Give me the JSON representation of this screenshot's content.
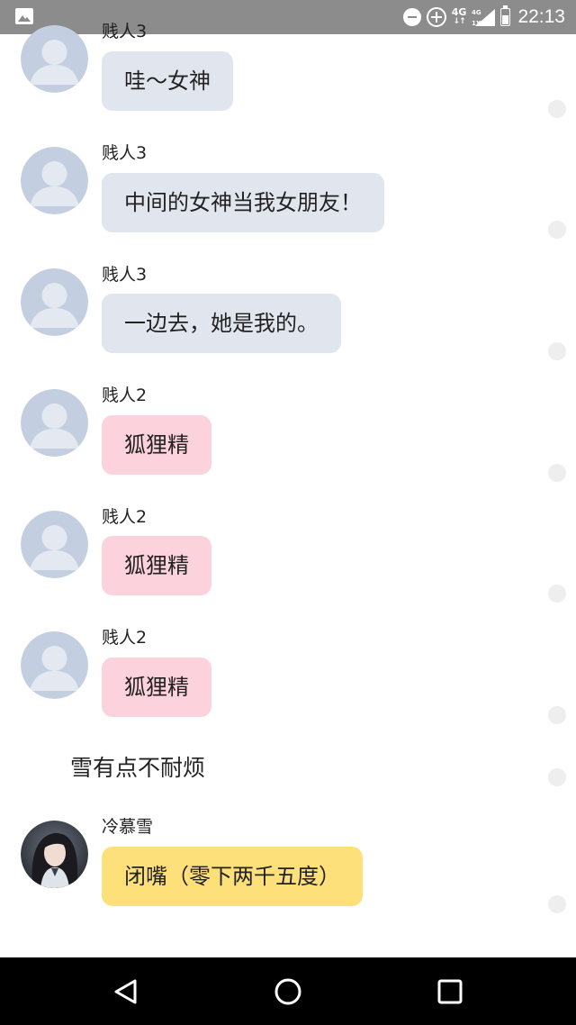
{
  "status_bar": {
    "time": "22:13",
    "network_top": "4G",
    "network_arrows": "↓↑",
    "signal_top": "4G",
    "signal_bottom": "1X",
    "icons": [
      "picture-icon",
      "dnd-icon",
      "data-saver-icon",
      "network-4g-icon",
      "signal-icon",
      "battery-icon"
    ],
    "battery_level": 0.6
  },
  "messages": [
    {
      "sender": "贱人3",
      "text": "哇～女神",
      "bubble_color": "#e1e6ee",
      "avatar": "default-avatar"
    },
    {
      "sender": "贱人3",
      "text": "中间的女神当我女朋友！",
      "bubble_color": "#e1e6ee",
      "avatar": "default-avatar"
    },
    {
      "sender": "贱人3",
      "text": "一边去，她是我的。",
      "bubble_color": "#e1e6ee",
      "avatar": "default-avatar"
    },
    {
      "sender": "贱人2",
      "text": "狐狸精",
      "bubble_color": "#fcd2dc",
      "avatar": "default-avatar"
    },
    {
      "sender": "贱人2",
      "text": "狐狸精",
      "bubble_color": "#fcd2dc",
      "avatar": "default-avatar"
    },
    {
      "sender": "贱人2",
      "text": "狐狸精",
      "bubble_color": "#fcd2dc",
      "avatar": "default-avatar"
    }
  ],
  "narration": "雪有点不耐烦",
  "last_message": {
    "sender": "冷慕雪",
    "text": "闭嘴（零下两千五度）",
    "bubble_color": "#fde07a",
    "avatar": "photo-avatar"
  },
  "navigation": [
    "back-icon",
    "home-icon",
    "recents-icon"
  ],
  "colors": {
    "status_bar": "#8c8c8c",
    "grey_bubble": "#e1e6ee",
    "pink_bubble": "#fcd2dc",
    "yellow_bubble": "#fde07a",
    "nav_bar": "#000000"
  }
}
